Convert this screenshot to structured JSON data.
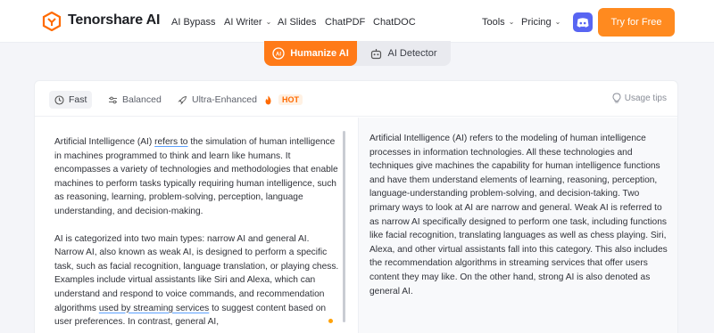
{
  "nav": {
    "brand": "Tenorshare AI",
    "links": [
      "AI Bypass",
      "AI Writer",
      "AI Slides",
      "ChatPDF",
      "ChatDOC"
    ],
    "tools": "Tools",
    "pricing": "Pricing",
    "cta": "Try for Free"
  },
  "switch": {
    "active": "Humanize AI",
    "inactive": "AI Detector"
  },
  "toolbar": {
    "modes": [
      "Fast",
      "Balanced",
      "Ultra-Enhanced"
    ],
    "hot_badge": "HOT",
    "tips": "Usage tips"
  },
  "input": {
    "p1_a": "Artificial Intelligence (AI) ",
    "p1_link": "refers to",
    "p1_b": " the simulation of human intelligence in machines programmed to think and learn like humans. It encompasses a variety of technologies and methodologies that enable machines to perform tasks typically requiring human intelligence, such as reasoning, learning, problem-solving, perception, language understanding, and decision-making.",
    "p2_a": "AI is categorized into two main types: narrow AI and general AI. Narrow AI, also known as weak AI, is designed to perform a specific task, such as facial recognition, language translation, or playing chess. Examples include virtual assistants like Siri and Alexa, which can understand and respond to voice commands, and recommendation algorithms ",
    "p2_link": "used by streaming services",
    "p2_b": " to suggest content based on user preferences. In contrast, general AI,"
  },
  "output": {
    "text": "Artificial Intelligence (AI) refers to the modeling of human intelligence processes in information technologies. All these technologies and techniques give machines the capability for human intelligence functions and have them understand elements of learning, reasoning, perception, language-understanding problem-solving, and decision-taking. Two primary ways to look at AI are narrow and general. Weak AI is referred to as narrow AI specifically designed to perform one task, including functions like facial recognition, translating languages as well as chess playing. Siri, Alexa, and other virtual assistants fall into this category. This also includes the recommendation algorithms in streaming services that offer users content they may like. On the other hand, strong AI is also denoted as general AI."
  },
  "colors": {
    "accent": "#ff7a18",
    "cta": "#ff8a1f",
    "discord": "#5865f2"
  },
  "icons": [
    "tenorshare-logo-icon",
    "chevron-down-icon",
    "discord-icon",
    "humanize-ai-icon",
    "robot-icon",
    "fast-icon",
    "balanced-icon",
    "rocket-icon",
    "fire-icon",
    "lightbulb-icon"
  ]
}
